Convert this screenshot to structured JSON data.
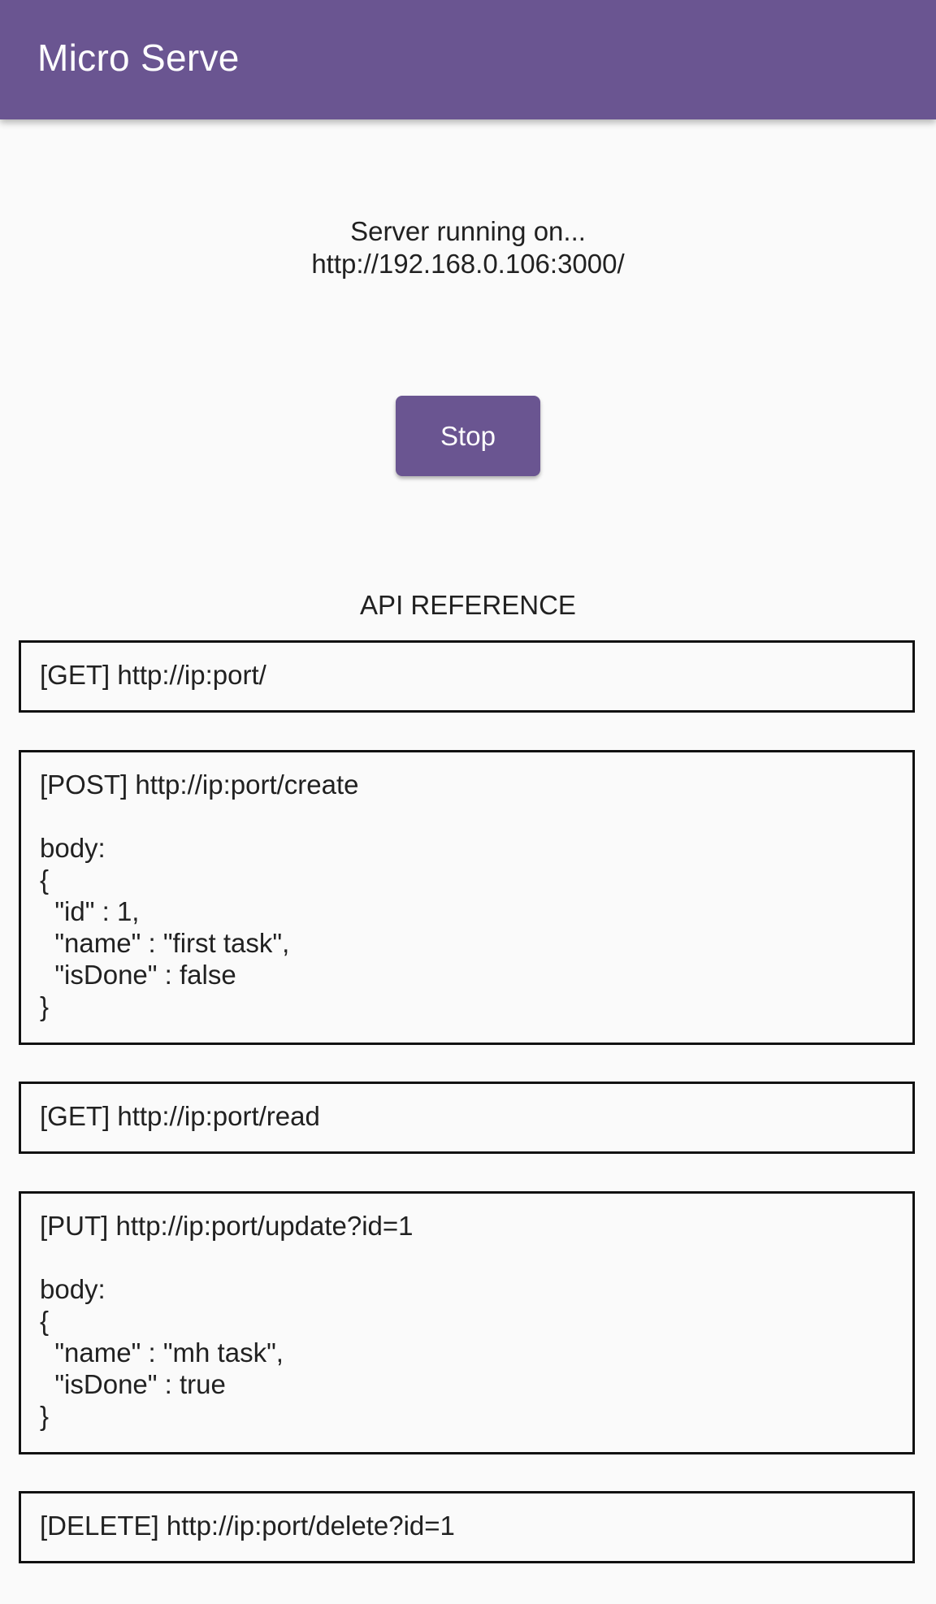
{
  "app_bar": {
    "title": "Micro Serve"
  },
  "status": {
    "line1": "Server running on...",
    "line2": "http://192.168.0.106:3000/"
  },
  "controls": {
    "stop_label": "Stop"
  },
  "api_reference": {
    "heading": "API REFERENCE",
    "endpoints": [
      {
        "text": "[GET] http://ip:port/"
      },
      {
        "text": "[POST] http://ip:port/create\n\nbody:\n{\n  \"id\" : 1,\n  \"name\" : \"first task\",\n  \"isDone\" : false\n}"
      },
      {
        "text": "[GET] http://ip:port/read"
      },
      {
        "text": "[PUT] http://ip:port/update?id=1\n\nbody:\n{\n  \"name\" : \"mh task\",\n  \"isDone\" : true\n}"
      },
      {
        "text": "[DELETE] http://ip:port/delete?id=1"
      }
    ]
  },
  "colors": {
    "primary": "#6a5591",
    "background": "#fafafa",
    "border": "#111111"
  }
}
